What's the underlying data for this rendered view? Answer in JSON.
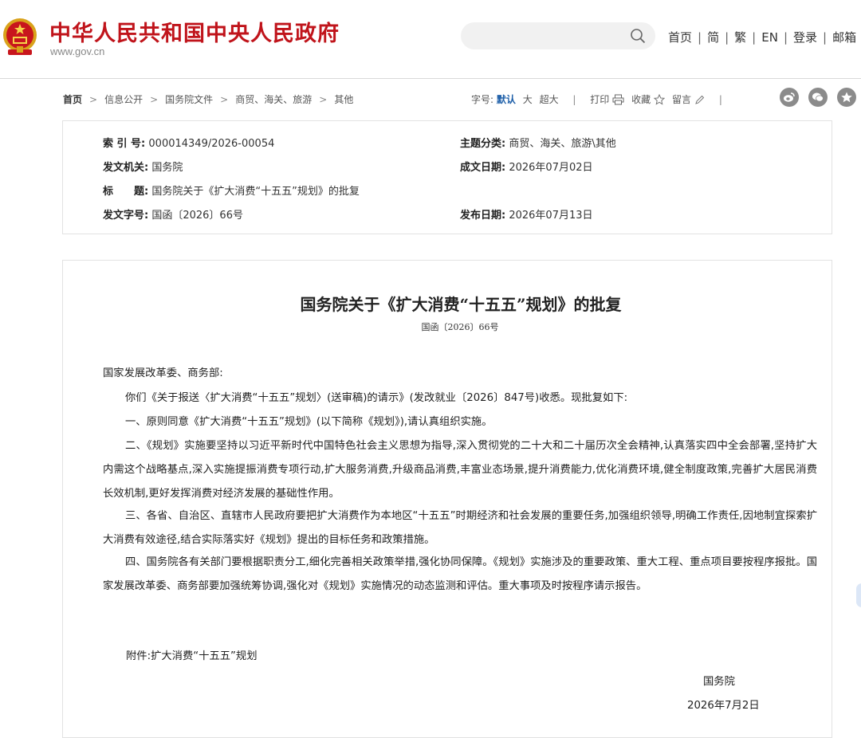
{
  "header": {
    "site_title": "中华人民共和国中央人民政府",
    "site_url": "www.gov.cn",
    "nav": [
      "首页",
      "简",
      "繁",
      "EN",
      "登录",
      "邮箱"
    ]
  },
  "breadcrumb": [
    "首页",
    "信息公开",
    "国务院文件",
    "商贸、海关、旅游",
    "其他"
  ],
  "toolbar": {
    "font_size_label": "字号:",
    "font_default": "默认",
    "font_large": "大",
    "font_xlarge": "超大",
    "print": "打印",
    "favorite": "收藏",
    "comment": "留言"
  },
  "meta": {
    "index_label": "索 引 号:",
    "index_value": "000014349/2026-00054",
    "topic_label": "主题分类:",
    "topic_value": "商贸、海关、旅游\\其他",
    "issuer_label": "发文机关:",
    "issuer_value": "国务院",
    "date_written_label": "成文日期:",
    "date_written_value": "2026年07月02日",
    "title_label": "标　　题:",
    "title_value": "国务院关于《扩大消费“十五五”规划》的批复",
    "doc_no_label": "发文字号:",
    "doc_no_value": "国函〔2026〕66号",
    "publish_date_label": "发布日期:",
    "publish_date_value": "2026年07月13日"
  },
  "document": {
    "title": "国务院关于《扩大消费“十五五”规划》的批复",
    "number": "国函〔2026〕66号",
    "salutation": "国家发展改革委、商务部:",
    "paragraphs": [
      "你们《关于报送〈扩大消费“十五五”规划〉(送审稿)的请示》(发改就业〔2026〕847号)收悉。现批复如下:",
      "一、原则同意《扩大消费“十五五”规划》(以下简称《规划》),请认真组织实施。",
      "二、《规划》实施要坚持以习近平新时代中国特色社会主义思想为指导,深入贯彻党的二十大和二十届历次全会精神,认真落实四中全会部署,坚持扩大内需这个战略基点,深入实施提振消费专项行动,扩大服务消费,升级商品消费,丰富业态场景,提升消费能力,优化消费环境,健全制度政策,完善扩大居民消费长效机制,更好发挥消费对经济发展的基础性作用。",
      "三、各省、自治区、直辖市人民政府要把扩大消费作为本地区“十五五”时期经济和社会发展的重要任务,加强组织领导,明确工作责任,因地制宜探索扩大消费有效途径,结合实际落实好《规划》提出的目标任务和政策措施。",
      "四、国务院各有关部门要根据职责分工,细化完善相关政策举措,强化协同保障。《规划》实施涉及的重要政策、重大工程、重点项目要按程序报批。国家发展改革委、商务部要加强统筹协调,强化对《规划》实施情况的动态监测和评估。重大事项及时按程序请示报告。"
    ],
    "attachment": "附件:扩大消费“十五五”规划",
    "signer": "国务院",
    "sign_date": "2026年7月2日"
  },
  "colors": {
    "brand_red": "#c0141b",
    "link_blue": "#1c5ea8",
    "share_gray": "#8b8b8b"
  },
  "icons": [
    "national-emblem-icon",
    "search-icon",
    "print-icon",
    "star-icon",
    "pencil-icon",
    "weibo-icon",
    "wechat-icon",
    "favorite-circle-icon"
  ]
}
